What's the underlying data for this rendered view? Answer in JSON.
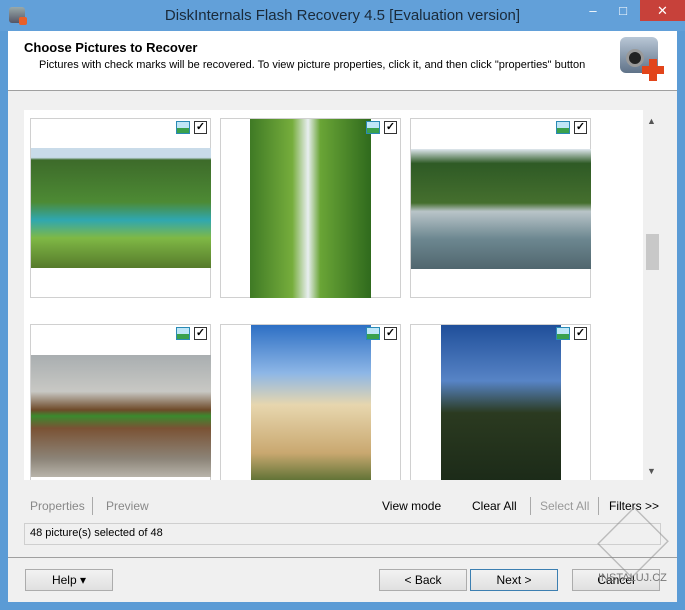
{
  "window": {
    "title": "DiskInternals Flash Recovery 4.5 [Evaluation version]",
    "minimize": "–",
    "maximize": "□",
    "close": "✕"
  },
  "header": {
    "title": "Choose Pictures to Recover",
    "subtitle": "Pictures with check marks will be recovered. To view picture properties, click it, and then click \"properties\" button"
  },
  "pictures": [
    {
      "desc": "lake",
      "checked": "✓"
    },
    {
      "desc": "waterfall",
      "checked": "✓"
    },
    {
      "desc": "boat",
      "checked": "✓"
    },
    {
      "desc": "flower-log",
      "checked": "✓"
    },
    {
      "desc": "building",
      "checked": "✓"
    },
    {
      "desc": "palm",
      "checked": "✓"
    }
  ],
  "toolbar": {
    "properties": "Properties",
    "preview": "Preview",
    "view_mode": "View mode",
    "clear_all": "Clear All",
    "select_all": "Select All",
    "filters": "Filters >>"
  },
  "status": "48 picture(s) selected of 48",
  "buttons": {
    "help": "Help ▾",
    "back": "< Back",
    "next": "Next >",
    "cancel": "Cancel"
  },
  "watermark": "INSTALUJ.CZ"
}
